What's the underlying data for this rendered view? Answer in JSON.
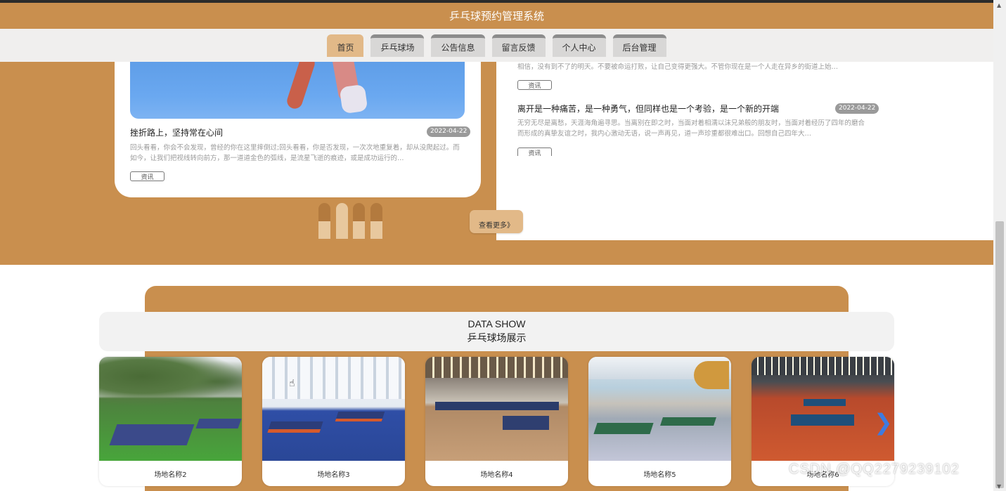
{
  "header": {
    "title": "乒乓球预约管理系统"
  },
  "nav": {
    "items": [
      {
        "label": "首页",
        "active": true
      },
      {
        "label": "乒乓球场",
        "active": false
      },
      {
        "label": "公告信息",
        "active": false
      },
      {
        "label": "留言反馈",
        "active": false
      },
      {
        "label": "个人中心",
        "active": false
      },
      {
        "label": "后台管理",
        "active": false
      }
    ]
  },
  "news_main": {
    "title": "挫折路上，坚持常在心间",
    "date": "2022-04-22",
    "desc": "回头看看，你会不会发现，曾经的你在这里摔倒过;回头看看，你是否发现，一次次地重复着，却从没爬起过。而如今，让我们把视线转向前方，那一道道金色的弧线，是流星飞逝的痕迹，或是成功运行的…",
    "tag": "资讯"
  },
  "news_side": [
    {
      "desc": "相信，没有到不了的明天。不要被命运打败，让自己变得更强大。不管你现在是一个人走在异乡的街道上始…",
      "tag": "资讯"
    },
    {
      "title": "离开是一种痛苦，是一种勇气，但同样也是一个考验，是一个新的开端",
      "date": "2022-04-22",
      "desc": "无穷无尽是离愁，天涯海角遍寻思。当离别在即之时，当面对着相濡以沫兄弟般的朋友时，当面对着经历了四年的磨合而形成的真挚友谊之时，我内心激动无语，说一声再见，道一声珍重都很难出口。回想自己四年大…",
      "tag": "资讯"
    }
  ],
  "more_button": "查看更多》",
  "data_show": {
    "title_en": "DATA SHOW",
    "title_cn": "乒乓球场展示",
    "venues": [
      {
        "name": "场地名称2"
      },
      {
        "name": "场地名称3"
      },
      {
        "name": "场地名称4"
      },
      {
        "name": "场地名称5"
      },
      {
        "name": "场地名称6"
      }
    ]
  },
  "watermark": "CSDN @QQ2279239102",
  "colors": {
    "brand": "#c98f4e",
    "active_nav": "#e2b988",
    "badge": "#9a9a9a"
  }
}
